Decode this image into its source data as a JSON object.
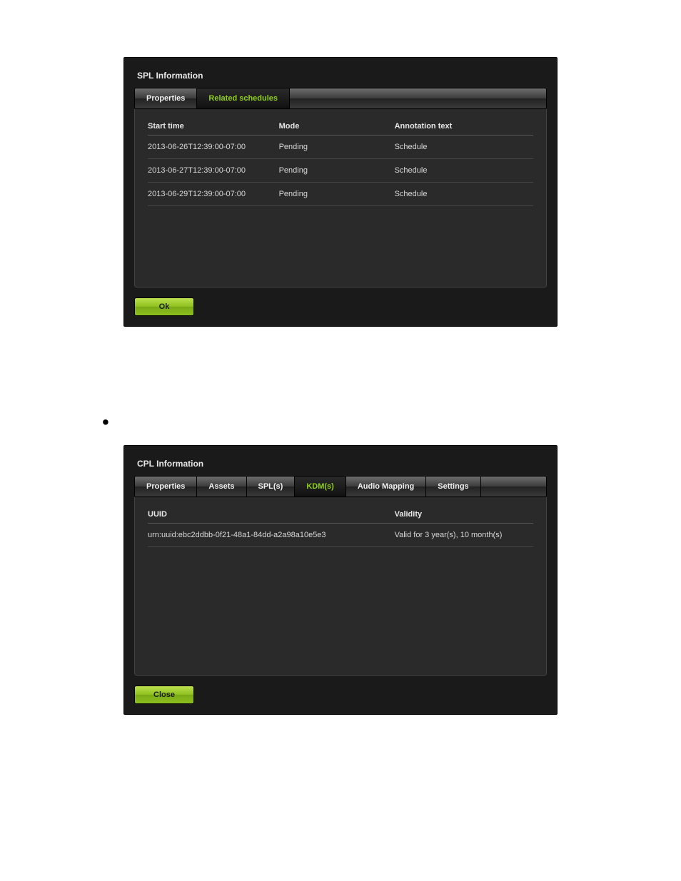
{
  "spl_panel": {
    "title": "SPL Information",
    "tabs": [
      {
        "label": "Properties",
        "active": false
      },
      {
        "label": "Related schedules",
        "active": true
      }
    ],
    "columns": {
      "start_time": "Start time",
      "mode": "Mode",
      "annotation": "Annotation text"
    },
    "rows": [
      {
        "start_time": "2013-06-26T12:39:00-07:00",
        "mode": "Pending",
        "annotation": "Schedule"
      },
      {
        "start_time": "2013-06-27T12:39:00-07:00",
        "mode": "Pending",
        "annotation": "Schedule"
      },
      {
        "start_time": "2013-06-29T12:39:00-07:00",
        "mode": "Pending",
        "annotation": "Schedule"
      }
    ],
    "ok_label": "Ok"
  },
  "cpl_panel": {
    "title": "CPL Information",
    "tabs": [
      {
        "label": "Properties",
        "active": false
      },
      {
        "label": "Assets",
        "active": false
      },
      {
        "label": "SPL(s)",
        "active": false
      },
      {
        "label": "KDM(s)",
        "active": true
      },
      {
        "label": "Audio Mapping",
        "active": false
      },
      {
        "label": "Settings",
        "active": false
      }
    ],
    "columns": {
      "uuid": "UUID",
      "validity": "Validity"
    },
    "rows": [
      {
        "uuid": "urn:uuid:ebc2ddbb-0f21-48a1-84dd-a2a98a10e5e3",
        "validity": "Valid for 3 year(s), 10 month(s)"
      }
    ],
    "close_label": "Close"
  }
}
